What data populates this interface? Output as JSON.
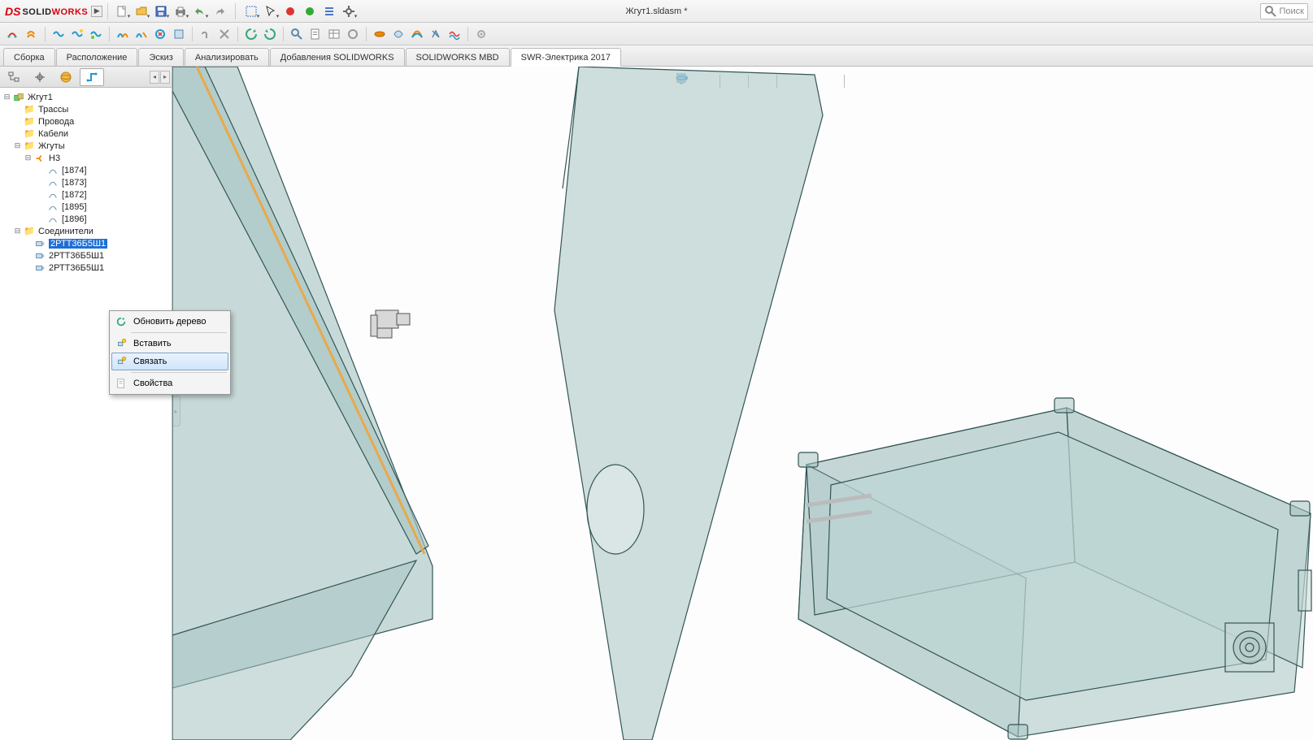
{
  "title_doc": "Жгут1.sldasm *",
  "search_placeholder": "Поиск",
  "logo": {
    "ds": "DS",
    "solid": "SOLID",
    "works": "WORKS"
  },
  "cmd_tabs": [
    "Сборка",
    "Расположение",
    "Эскиз",
    "Анализировать",
    "Добавления SOLIDWORKS",
    "SOLIDWORKS MBD",
    "SWR-Электрика 2017"
  ],
  "cmd_tab_active": 6,
  "tree": {
    "root": "Жгут1",
    "folders": [
      "Трассы",
      "Провода",
      "Кабели"
    ],
    "zhguty_label": "Жгуты",
    "h3_label": "H3",
    "h3_items": [
      "[1874]",
      "[1873]",
      "[1872]",
      "[1895]",
      "[1896]"
    ],
    "connectors_label": "Соединители",
    "connectors": [
      "2РТТ36Б5Ш1",
      "2РТТ36Б5Ш1",
      "2РТТ36Б5Ш1"
    ],
    "connector_selected_display": "2РТТ36Б5Ш1"
  },
  "ctx": {
    "refresh": "Обновить дерево",
    "insert": "Вставить",
    "link": "Связать",
    "props": "Свойства"
  }
}
